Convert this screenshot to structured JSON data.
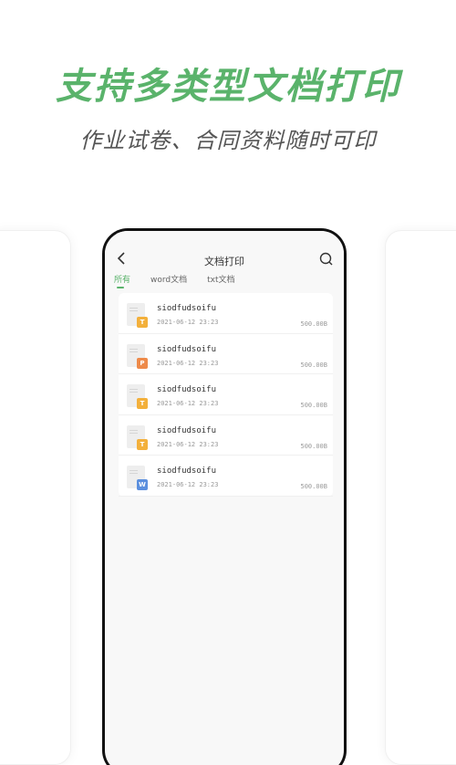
{
  "promo": {
    "headline": "支持多类型文档打印",
    "subline": "作业试卷、合同资料随时可印"
  },
  "colors": {
    "accent": "#5ab36b",
    "badge_t": "#f3b03b",
    "badge_p": "#ee8a4a",
    "badge_w": "#5b8fde"
  },
  "screen": {
    "title": "文档打印",
    "back_icon": "chevron-left-icon",
    "search_icon": "search-icon",
    "tabs": [
      {
        "label": "所有"
      },
      {
        "label": "word文档"
      },
      {
        "label": "txt文档"
      }
    ],
    "files": [
      {
        "name": "siodfudsoifu",
        "date": "2021-06-12 23:23",
        "size": "500.00B",
        "badge": "T"
      },
      {
        "name": "siodfudsoifu",
        "date": "2021-06-12 23:23",
        "size": "500.00B",
        "badge": "P"
      },
      {
        "name": "siodfudsoifu",
        "date": "2021-06-12 23:23",
        "size": "500.00B",
        "badge": "T"
      },
      {
        "name": "siodfudsoifu",
        "date": "2021-06-12 23:23",
        "size": "500.00B",
        "badge": "T"
      },
      {
        "name": "siodfudsoifu",
        "date": "2021-06-12 23:23",
        "size": "500.00B",
        "badge": "W"
      }
    ]
  }
}
